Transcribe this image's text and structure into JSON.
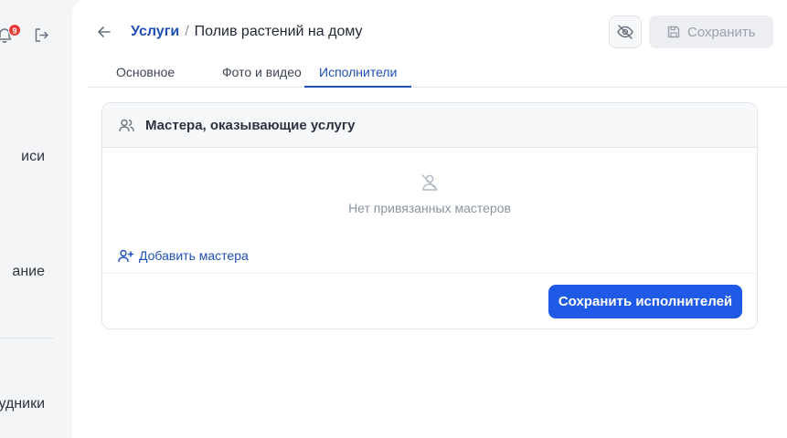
{
  "sidebar": {
    "notification_count": "9",
    "items": [
      {
        "label": "иси"
      },
      {
        "label": "ание"
      },
      {
        "label": "удники"
      }
    ]
  },
  "header": {
    "breadcrumb_parent": "Услуги",
    "breadcrumb_separator": "/",
    "breadcrumb_current": "Полив растений на дому",
    "save_label": "Сохранить"
  },
  "tabs": [
    {
      "label": "Основное"
    },
    {
      "label": "Фото и видео"
    },
    {
      "label": "Исполнители"
    }
  ],
  "card": {
    "title": "Мастера, оказывающие услугу",
    "empty_text": "Нет привязанных мастеров",
    "add_label": "Добавить мастера",
    "save_button": "Сохранить исполнителей"
  },
  "colors": {
    "accent": "#1f5ae6",
    "link": "#1f4fb8",
    "badge": "#e53935"
  }
}
